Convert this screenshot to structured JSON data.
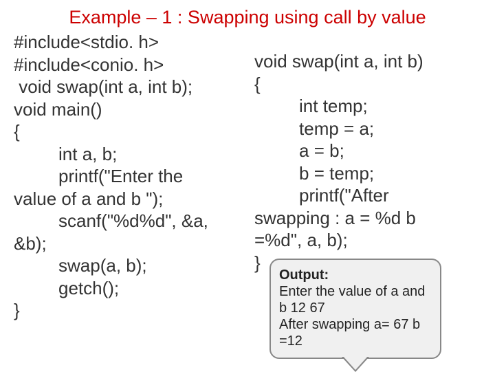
{
  "title": "Example – 1 : Swapping using call by value",
  "left_code": "#include<stdio. h>\n#include<conio. h>\n void swap(int a, int b);\nvoid main()\n{\n         int a, b;\n         printf(\"Enter the\nvalue of a and b \");\n         scanf(\"%d%d\", &a,\n&b);\n         swap(a, b);\n         getch();\n}",
  "right_code": "void swap(int a, int b)\n{\n         int temp;\n         temp = a;\n         a = b;\n         b = temp;\n         printf(\"After\nswapping : a = %d b\n=%d\", a, b);\n}",
  "output": {
    "title": "Output:",
    "line1": "Enter the value of a and b 12 67",
    "line2": " After swapping a= 67 b =12"
  }
}
